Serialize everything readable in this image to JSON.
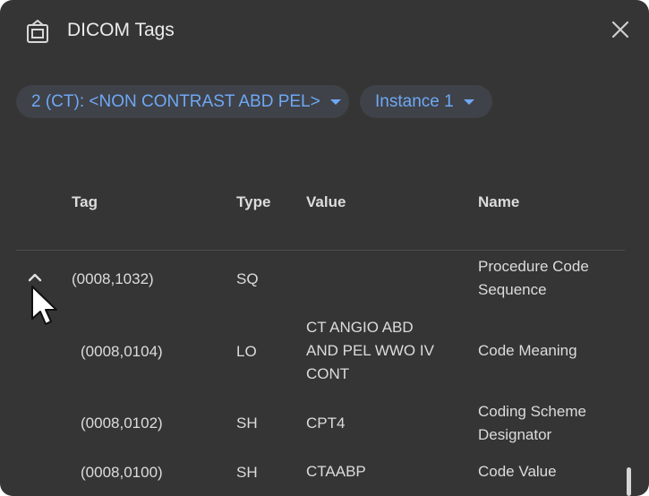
{
  "dialog": {
    "title": "DICOM Tags",
    "icon": "dicom-tags-icon",
    "close_icon": "close-icon"
  },
  "selectors": {
    "series": "2 (CT): <NON CONTRAST ABD PEL>",
    "instance": "Instance 1"
  },
  "table": {
    "headers": {
      "tag": "Tag",
      "type": "Type",
      "value": "Value",
      "name": "Name"
    },
    "rows": [
      {
        "tag": "(0008,1032)",
        "type": "SQ",
        "value": "",
        "name": [
          "Procedure Code",
          "Sequence"
        ],
        "expanded": true
      },
      {
        "tag": "(0008,0104)",
        "type": "LO",
        "value": [
          "CT ANGIO ABD",
          "AND PEL WWO IV",
          "CONT"
        ],
        "name": [
          "Code Meaning"
        ]
      },
      {
        "tag": "(0008,0102)",
        "type": "SH",
        "value": [
          "CPT4"
        ],
        "name": [
          "Coding Scheme",
          "Designator"
        ]
      },
      {
        "tag": "(0008,0100)",
        "type": "SH",
        "value": [
          "CTAABP"
        ],
        "name": [
          "Code Value"
        ]
      }
    ]
  },
  "colors": {
    "dialog_bg": "#353535",
    "chip_bg": "#3f4248",
    "chip_text": "#6fa8f5",
    "text": "#dcdcdc"
  }
}
